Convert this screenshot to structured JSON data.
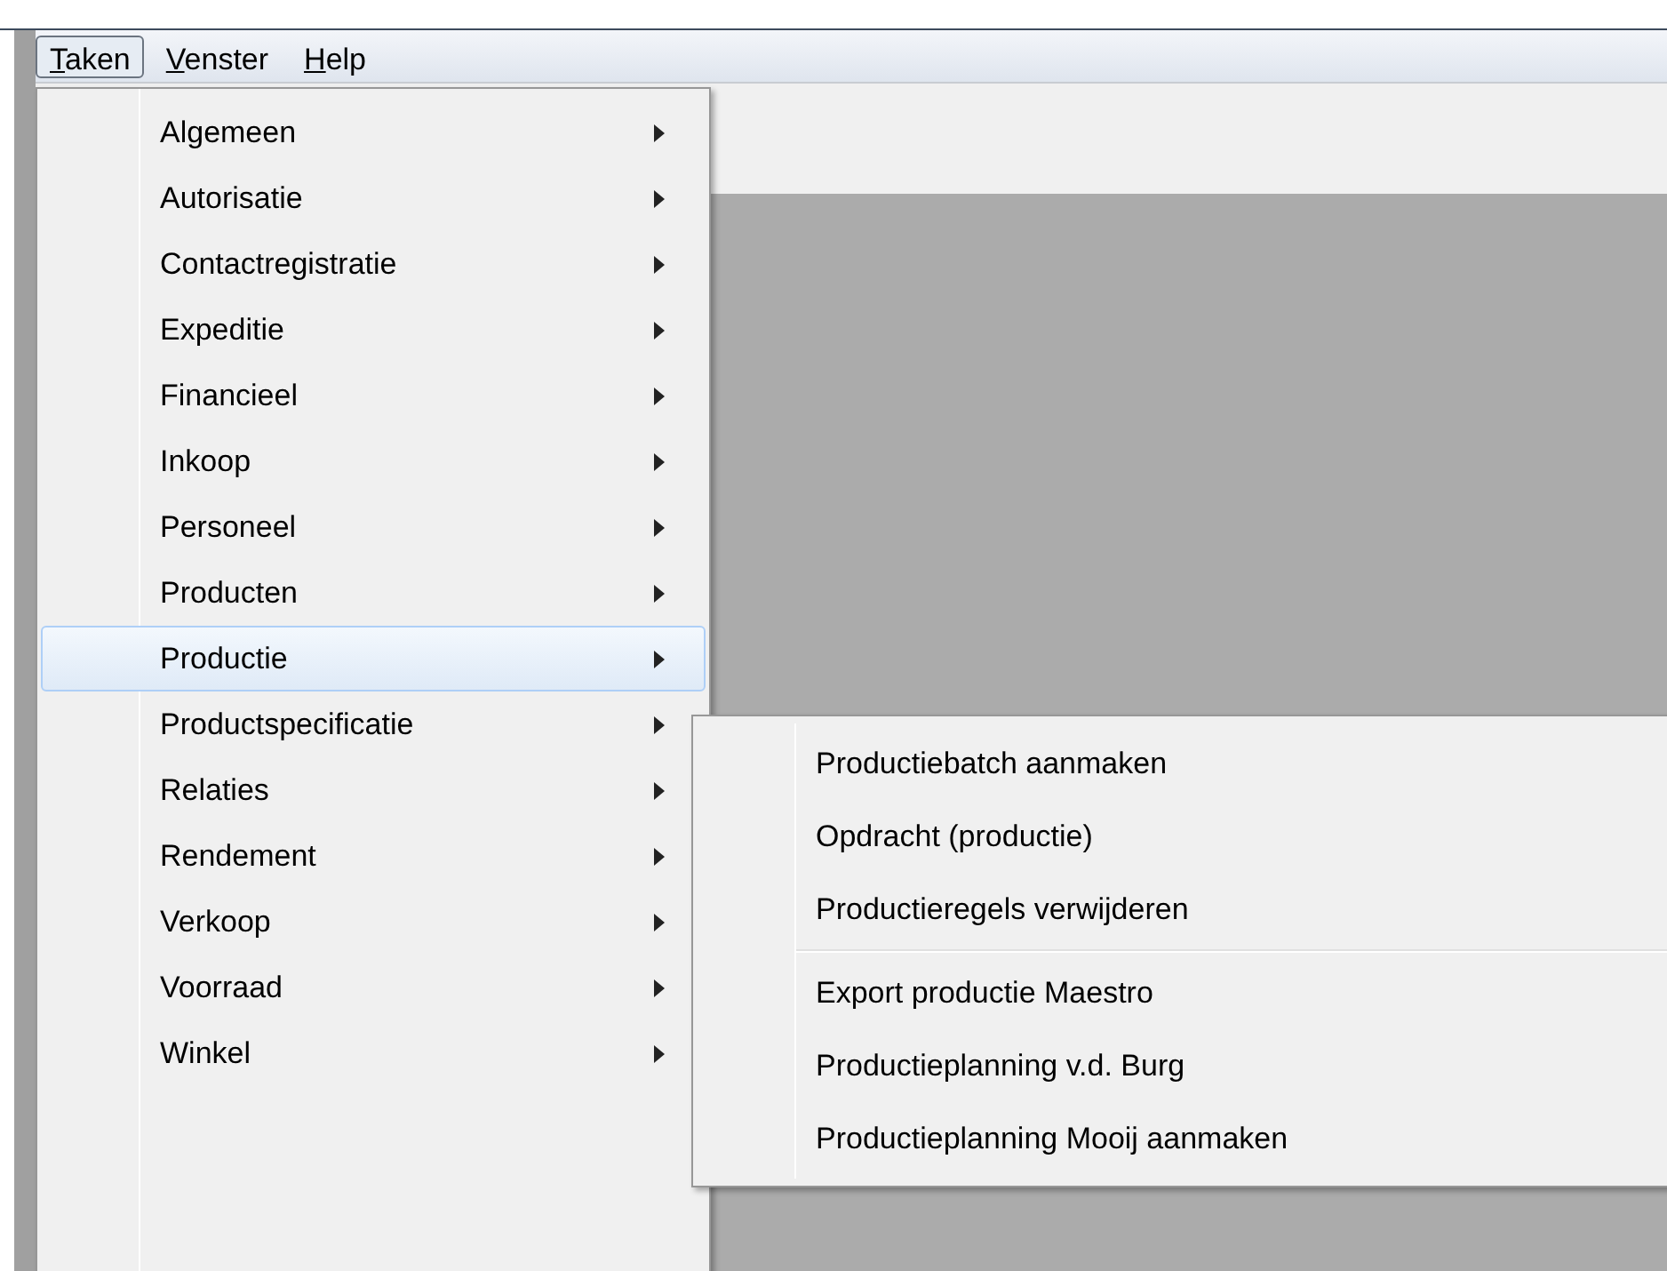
{
  "menubar": [
    {
      "label": "Taken",
      "underline_first": true,
      "selected": true
    },
    {
      "label": "Venster",
      "underline_first": true,
      "selected": false
    },
    {
      "label": "Help",
      "underline_first": true,
      "selected": false
    }
  ],
  "menu": {
    "items": [
      {
        "label": "Algemeen",
        "submenu": true,
        "selected": false
      },
      {
        "label": "Autorisatie",
        "submenu": true,
        "selected": false
      },
      {
        "label": "Contactregistratie",
        "submenu": true,
        "selected": false
      },
      {
        "label": "Expeditie",
        "submenu": true,
        "selected": false
      },
      {
        "label": "Financieel",
        "submenu": true,
        "selected": false
      },
      {
        "label": "Inkoop",
        "submenu": true,
        "selected": false
      },
      {
        "label": "Personeel",
        "submenu": true,
        "selected": false
      },
      {
        "label": "Producten",
        "submenu": true,
        "selected": false
      },
      {
        "label": "Productie",
        "submenu": true,
        "selected": true
      },
      {
        "label": "Productspecificatie",
        "submenu": true,
        "selected": false
      },
      {
        "label": "Relaties",
        "submenu": true,
        "selected": false
      },
      {
        "label": "Rendement",
        "submenu": true,
        "selected": false
      },
      {
        "label": "Verkoop",
        "submenu": true,
        "selected": false
      },
      {
        "label": "Voorraad",
        "submenu": true,
        "selected": false
      },
      {
        "label": "Winkel",
        "submenu": true,
        "selected": false
      }
    ]
  },
  "submenu": {
    "items": [
      {
        "kind": "item",
        "label": "Productiebatch aanmaken"
      },
      {
        "kind": "item",
        "label": "Opdracht (productie)"
      },
      {
        "kind": "item",
        "label": "Productieregels verwijderen"
      },
      {
        "kind": "separator"
      },
      {
        "kind": "item",
        "label": "Export productie Maestro"
      },
      {
        "kind": "item",
        "label": "Productieplanning v.d. Burg"
      },
      {
        "kind": "item",
        "label": "Productieplanning Mooij aanmaken"
      }
    ]
  }
}
